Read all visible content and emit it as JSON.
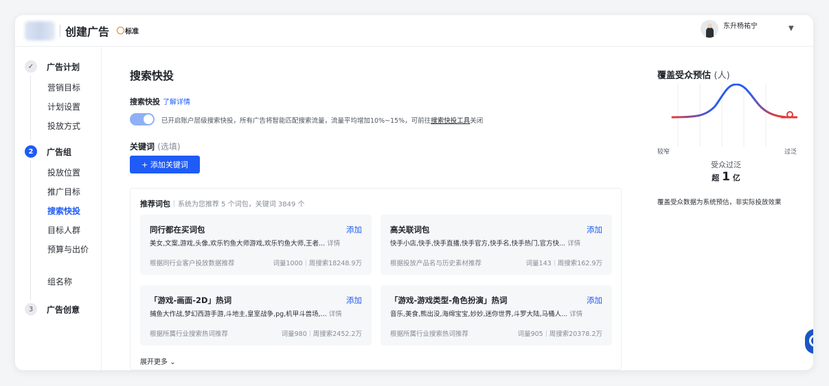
{
  "header": {
    "title": "创建广告",
    "mode": "标准",
    "user_name": "东升杨祐宁"
  },
  "sidebar": {
    "steps": [
      {
        "label": "广告计划",
        "number": "",
        "items": [
          "营销目标",
          "计划设置",
          "投放方式"
        ]
      },
      {
        "label": "广告组",
        "number": "2",
        "items": [
          "投放位置",
          "推广目标",
          "搜索快投",
          "目标人群",
          "预算与出价",
          "组名称"
        ]
      },
      {
        "label": "广告创意",
        "number": "3",
        "items": []
      }
    ],
    "active_item": "搜索快投"
  },
  "main": {
    "title": "搜索快投",
    "quick_search": {
      "label": "搜索快投",
      "link": "了解详情",
      "toggle_on": true,
      "desc_before": "已开启账户层级搜索快投，所有广告将智能匹配搜索流量，流量平均增加10%~15%，可前往",
      "desc_link": "搜索快投工具",
      "desc_after": "关闭"
    },
    "keywords": {
      "label": "关键词",
      "optional": "(选填)",
      "add_button": "+ 添加关键词"
    },
    "recommend": {
      "title": "推荐词包",
      "hint": "系统为您推荐 5 个词包，关键词 3849 个",
      "more": "展开更多",
      "cards": [
        {
          "title": "同行都在买词包",
          "add": "添加",
          "keywords": "美女,文案,游戏,头像,欢乐钓鱼大师游戏,欢乐钓鱼大师,王者...",
          "detail": "详情",
          "source": "根据同行业客户投放数据推荐",
          "count": "词量1000",
          "volume": "周搜索18248.9万"
        },
        {
          "title": "高关联词包",
          "add": "添加",
          "keywords": "快手小店,快手,快手直播,快手官方,快手名,快手热门,官方快...",
          "detail": "详情",
          "source": "根据投放产品名与历史素材推荐",
          "count": "词量143",
          "volume": "周搜索162.9万"
        },
        {
          "title": "「游戏-画面-2D」热词",
          "add": "添加",
          "keywords": "捕鱼大作战,梦幻西游手游,斗地主,皇室战争,pg,机甲斗兽场,...",
          "detail": "详情",
          "source": "根据所属行业搜索热词推荐",
          "count": "词量980",
          "volume": "周搜索2452.2万"
        },
        {
          "title": "「游戏-游戏类型-角色扮演」热词",
          "add": "添加",
          "keywords": "音乐,美食,熊出没,海绵宝宝,妙妙,迷你世界,斗罗大陆,马桶人...",
          "detail": "详情",
          "source": "根据所属行业搜索热词推荐",
          "count": "词量905",
          "volume": "周搜索20378.2万"
        }
      ]
    }
  },
  "audience": {
    "title": "覆盖受众预估",
    "unit": "(人)",
    "label_left": "较窄",
    "label_right": "过泛",
    "state": "受众过泛",
    "prefix": "超",
    "value": "1",
    "suffix": "亿",
    "note": "覆盖受众数据为系统预估，非实际投放效果",
    "colors": {
      "low": "#e23b3b",
      "mid": "#2a5cf0"
    }
  }
}
